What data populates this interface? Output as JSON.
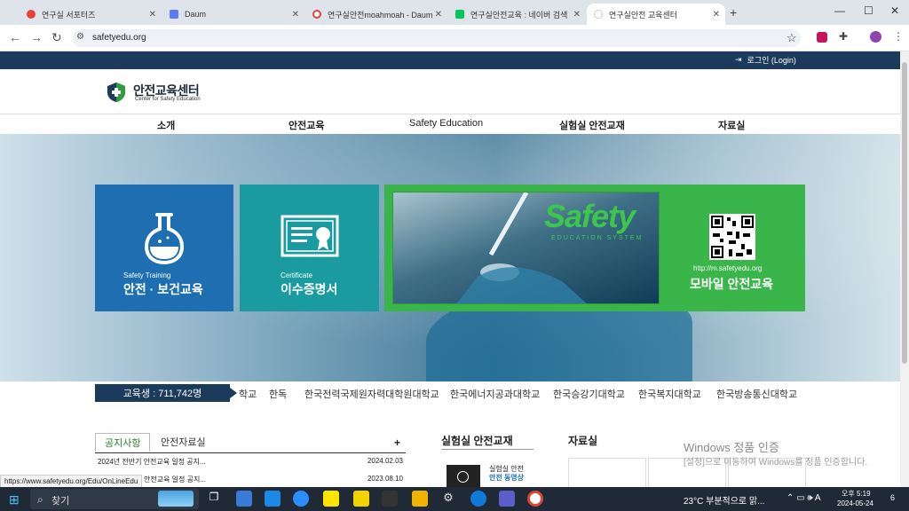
{
  "browser": {
    "tabs": [
      {
        "title": "연구실 서포터즈",
        "color": "#e94235"
      },
      {
        "title": "Daum",
        "color": "#5b7cfa"
      },
      {
        "title": "연구실안전moahmoah - Daum",
        "color": "#e84040"
      },
      {
        "title": "연구실안전교육 : 네이버 검색",
        "color": "#03c75a"
      },
      {
        "title": "연구실안전 교육센터",
        "color": "#ffffff"
      }
    ],
    "new_tab": "+",
    "url": "safetyedu.org",
    "status_url": "https://www.safetyedu.org/Edu/OnLineEdu"
  },
  "site": {
    "login": "로그인 (Login)",
    "logo_title": "안전교육센터",
    "logo_sub": "Center for Safety Education",
    "nav": [
      "소개",
      "안전교육",
      "Safety Education",
      "실험실 안전교재",
      "자료실"
    ],
    "tiles": [
      {
        "en": "Safety Training",
        "ko": "안전 · 보건교육"
      },
      {
        "en": "Certificate",
        "ko": "이수증명서"
      }
    ],
    "promo": {
      "title": "Safety",
      "subtitle": "EDUCATION SYSTEM",
      "mobile_url": "http://m.safetyedu.org",
      "mobile_label": "모바일 안전교육"
    },
    "ticker": {
      "count_label": "교육생 : 711,742명",
      "items": [
        "학교",
        "한독",
        "한국전력국제원자력대학원대학교",
        "한국에너지공과대학교",
        "한국승강기대학교",
        "한국복지대학교",
        "한국방송통신대학교"
      ]
    },
    "notice": {
      "tabs": [
        "공지사항",
        "안전자료실"
      ],
      "more": "+",
      "rows": [
        {
          "title": "2024년 전반기 안전교육 일정 공지...",
          "date": "2024.02.03"
        },
        {
          "title": "안전교육 일정 공지...",
          "date": "2023.08.10"
        }
      ]
    },
    "edu_section": {
      "title": "실험실 안전교재",
      "item_line1": "실험실 안전",
      "item_line2": "안전 동영상"
    },
    "data_section": {
      "title": "자료실"
    }
  },
  "os": {
    "watermark_title": "Windows 정품 인증",
    "watermark_text": "[설정]으로 이동하여 Windows를 정품 인증합니다.",
    "search_placeholder": "찾기",
    "weather": "23°C  부분적으로 맑...",
    "ime": "A",
    "time": "오후 5:19",
    "date": "2024-05-24",
    "notifications": "6"
  }
}
